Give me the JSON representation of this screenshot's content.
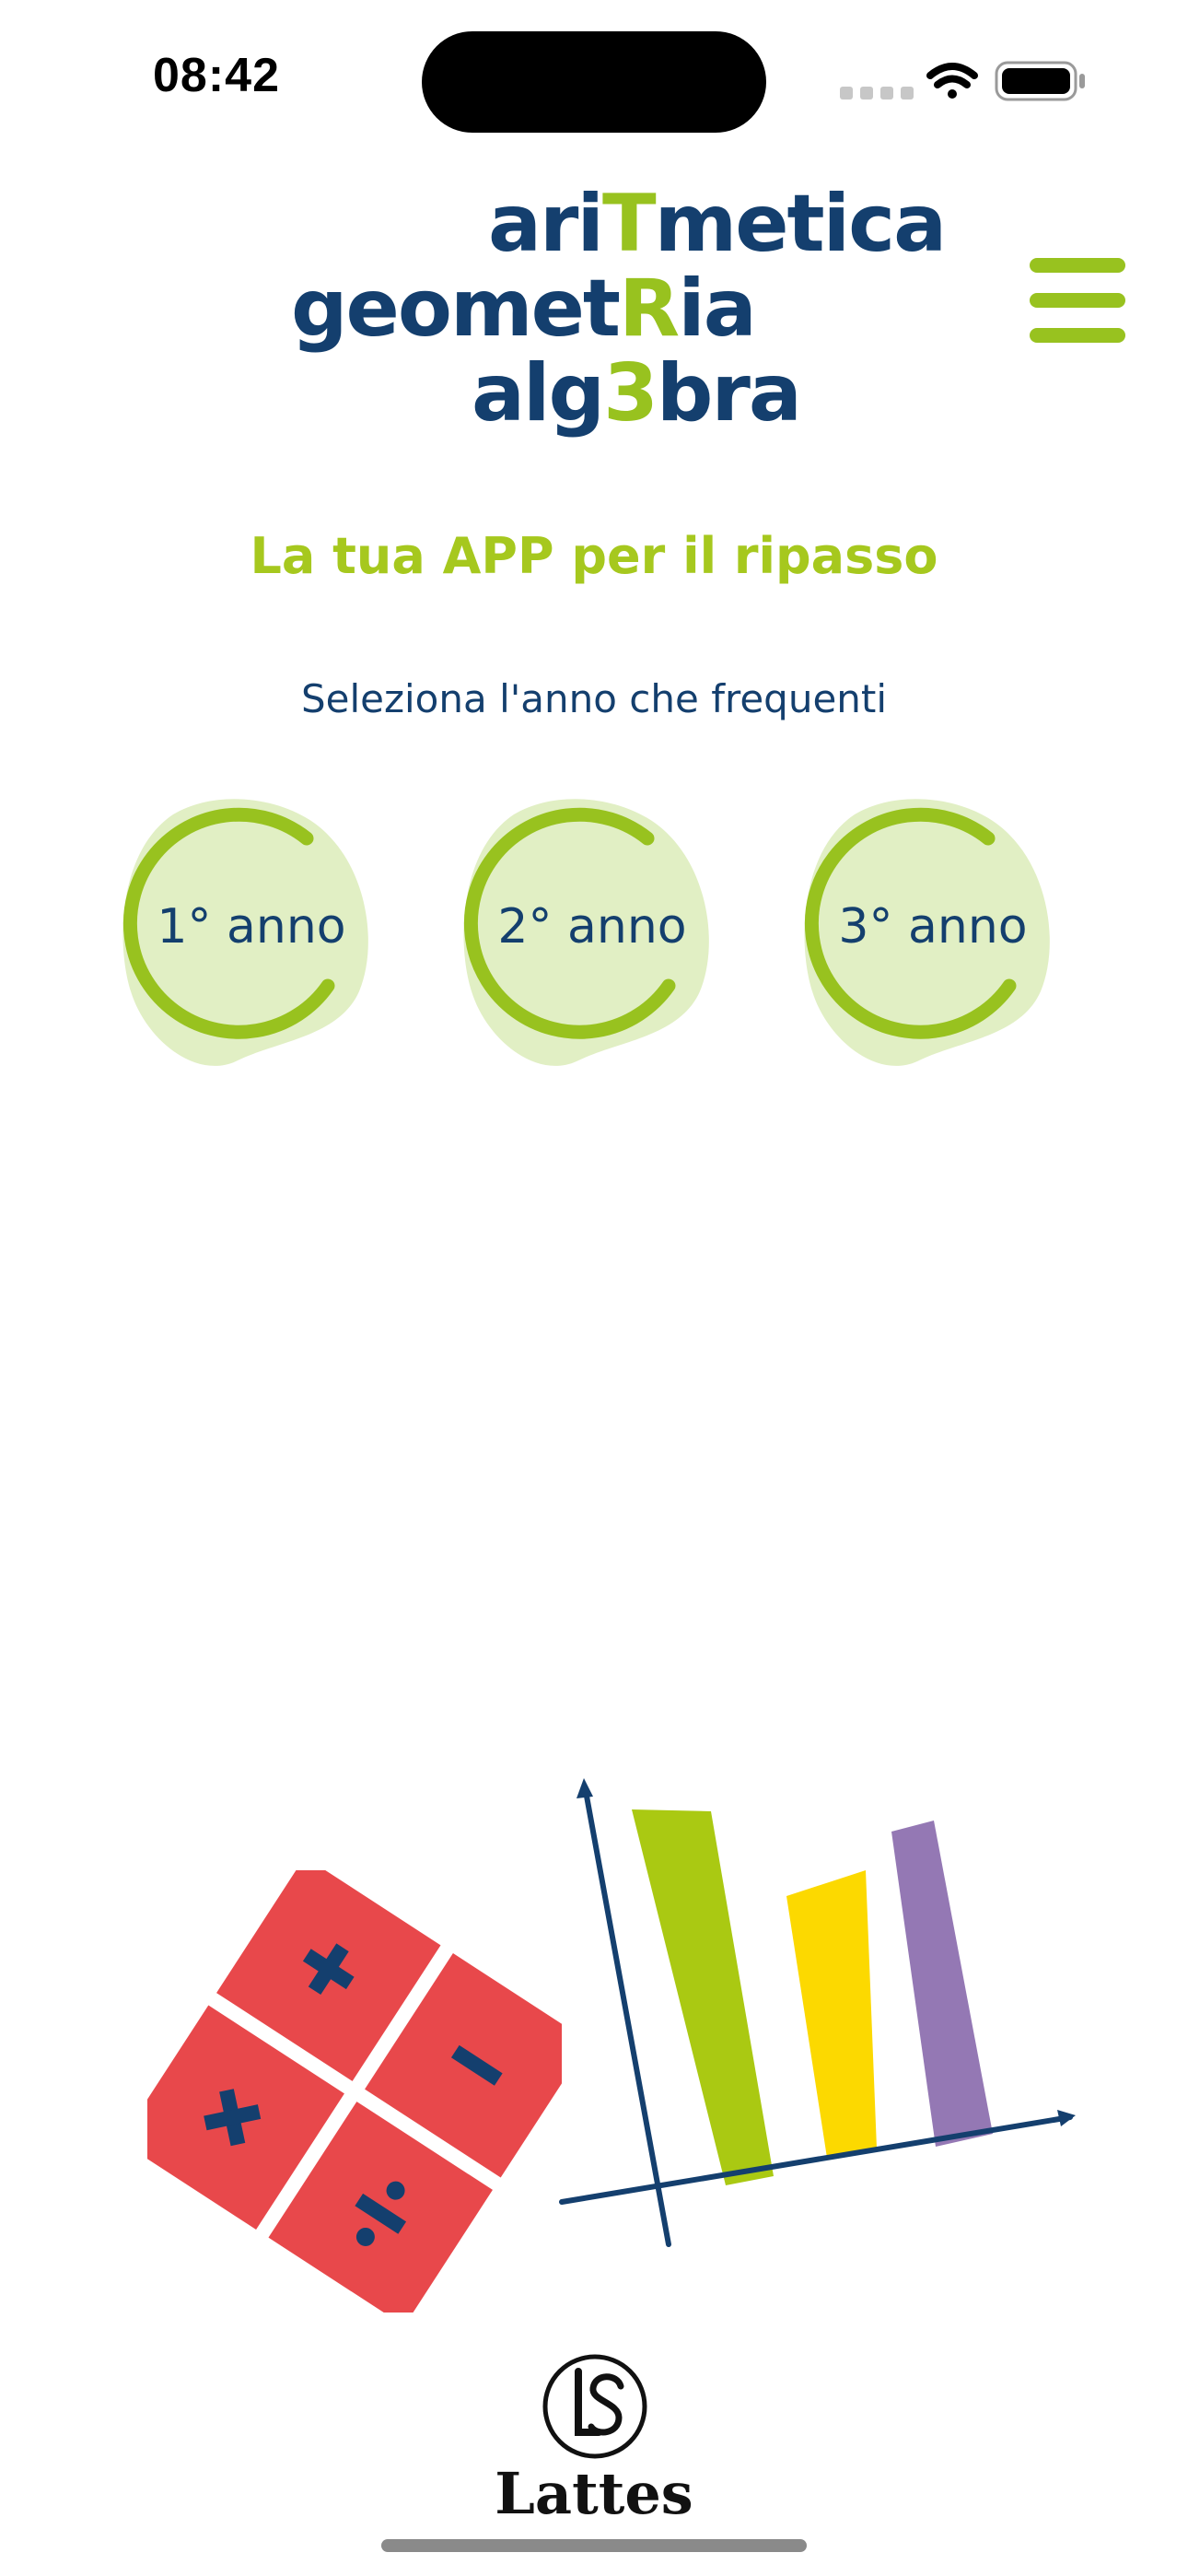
{
  "status_bar": {
    "time": "08:42",
    "icons": [
      "cellular-signal-icon",
      "wifi-icon",
      "battery-icon"
    ]
  },
  "logo": {
    "line1": {
      "pre": "ari",
      "highlight": "T",
      "post": "metica"
    },
    "line2": {
      "pre": "geomet",
      "highlight": "R",
      "post": "ia"
    },
    "line3": {
      "pre": "alg",
      "highlight": "3",
      "post": "bra"
    }
  },
  "menu": {
    "icon": "hamburger-menu-icon"
  },
  "tagline": "La tua APP per il ripasso",
  "subtitle": "Seleziona l'anno che frequenti",
  "years": [
    {
      "label": "1° anno"
    },
    {
      "label": "2° anno"
    },
    {
      "label": "3° anno"
    }
  ],
  "illustrations": {
    "operations_icon": "math-operations-icon",
    "chart_icon": "bar-chart-icon"
  },
  "publisher": {
    "name": "Lattes",
    "icon": "publisher-ls-logo-icon"
  },
  "colors": {
    "brand_blue": "#143f6e",
    "brand_green": "#98c21f",
    "blob_green": "#e1efc4",
    "tile_red": "#e8484b",
    "bar_green": "#aac912",
    "bar_yellow": "#fcd900",
    "bar_purple": "#9478b4"
  }
}
